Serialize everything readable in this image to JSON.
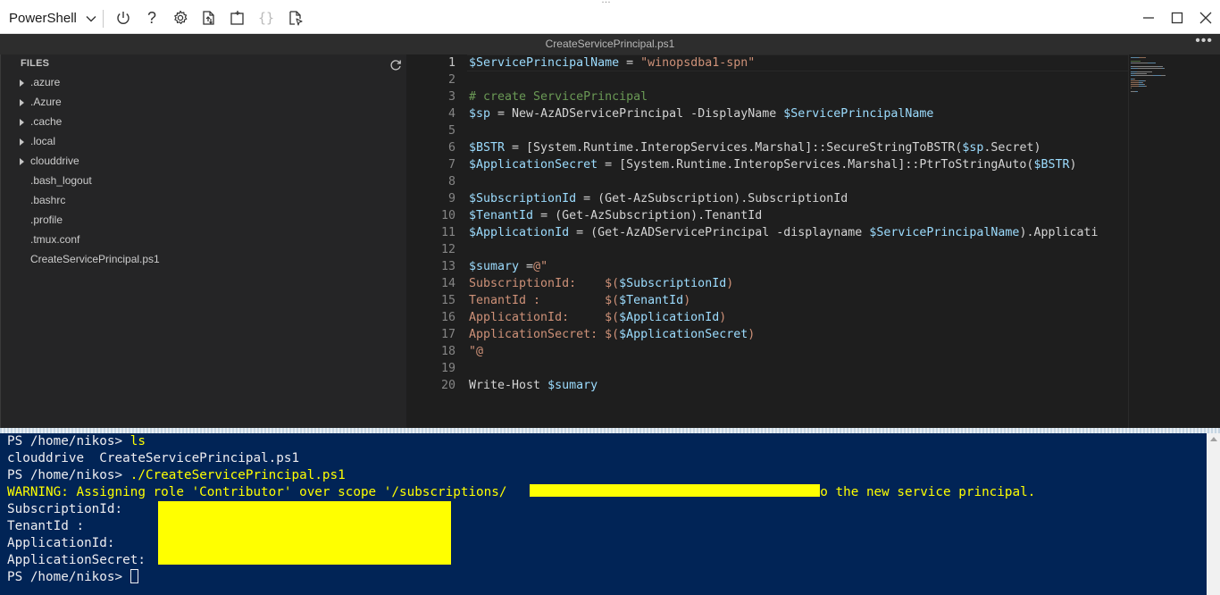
{
  "toolbar": {
    "shell_label": "PowerShell",
    "grip": "…",
    "buttons": [
      {
        "name": "restart",
        "icon": "power-icon"
      },
      {
        "name": "help",
        "icon": "help-icon",
        "glyph": "?"
      },
      {
        "name": "settings",
        "icon": "gear-icon"
      },
      {
        "name": "upload-download",
        "icon": "upload-download-icon"
      },
      {
        "name": "new-session",
        "icon": "new-session-icon"
      },
      {
        "name": "editor",
        "icon": "braces-icon",
        "glyph": "{}"
      },
      {
        "name": "web-preview",
        "icon": "web-preview-icon"
      }
    ],
    "window_controls": [
      "minimize-icon",
      "maximize-icon",
      "close-icon"
    ]
  },
  "editor": {
    "filename": "CreateServicePrincipal.ps1",
    "more_glyph": "•••",
    "active_line": 1,
    "line_numbers": [
      "1",
      "2",
      "3",
      "4",
      "5",
      "6",
      "7",
      "8",
      "9",
      "10",
      "11",
      "12",
      "13",
      "14",
      "15",
      "16",
      "17",
      "18",
      "19",
      "20"
    ],
    "code": [
      [
        {
          "t": "$ServicePrincipalName",
          "k": "v"
        },
        {
          "t": " = ",
          "k": "p"
        },
        {
          "t": "\"winopsdba1-spn\"",
          "k": "s"
        }
      ],
      [],
      [
        {
          "t": "# create ServicePrincipal",
          "k": "c"
        }
      ],
      [
        {
          "t": "$sp",
          "k": "v"
        },
        {
          "t": " = New-AzADServicePrincipal -DisplayName ",
          "k": "p"
        },
        {
          "t": "$ServicePrincipalName",
          "k": "v"
        }
      ],
      [],
      [
        {
          "t": "$BSTR",
          "k": "v"
        },
        {
          "t": " = [System.Runtime.InteropServices.Marshal]::SecureStringToBSTR(",
          "k": "p"
        },
        {
          "t": "$sp",
          "k": "v"
        },
        {
          "t": ".Secret)",
          "k": "p"
        }
      ],
      [
        {
          "t": "$ApplicationSecret",
          "k": "v"
        },
        {
          "t": " = [System.Runtime.InteropServices.Marshal]::PtrToStringAuto(",
          "k": "p"
        },
        {
          "t": "$BSTR",
          "k": "v"
        },
        {
          "t": ")",
          "k": "p"
        }
      ],
      [],
      [
        {
          "t": "$SubscriptionId",
          "k": "v"
        },
        {
          "t": " = (Get-AzSubscription).SubscriptionId",
          "k": "p"
        }
      ],
      [
        {
          "t": "$TenantId",
          "k": "v"
        },
        {
          "t": " = (Get-AzSubscription).TenantId",
          "k": "p"
        }
      ],
      [
        {
          "t": "$ApplicationId",
          "k": "v"
        },
        {
          "t": " = (Get-AzADServicePrincipal -displayname ",
          "k": "p"
        },
        {
          "t": "$ServicePrincipalName",
          "k": "v"
        },
        {
          "t": ").Applicati",
          "k": "p"
        }
      ],
      [],
      [
        {
          "t": "$sumary",
          "k": "v"
        },
        {
          "t": " =",
          "k": "p"
        },
        {
          "t": "@\"",
          "k": "s"
        }
      ],
      [
        {
          "t": "SubscriptionId:    $(",
          "k": "s"
        },
        {
          "t": "$SubscriptionId",
          "k": "v"
        },
        {
          "t": ")",
          "k": "s"
        }
      ],
      [
        {
          "t": "TenantId :         $(",
          "k": "s"
        },
        {
          "t": "$TenantId",
          "k": "v"
        },
        {
          "t": ")",
          "k": "s"
        }
      ],
      [
        {
          "t": "ApplicationId:     $(",
          "k": "s"
        },
        {
          "t": "$ApplicationId",
          "k": "v"
        },
        {
          "t": ")",
          "k": "s"
        }
      ],
      [
        {
          "t": "ApplicationSecret: $(",
          "k": "s"
        },
        {
          "t": "$ApplicationSecret",
          "k": "v"
        },
        {
          "t": ")",
          "k": "s"
        }
      ],
      [
        {
          "t": "\"@",
          "k": "s"
        }
      ],
      [],
      [
        {
          "t": "Write-Host ",
          "k": "p"
        },
        {
          "t": "$sumary",
          "k": "v"
        }
      ]
    ]
  },
  "explorer": {
    "header": "FILES",
    "items": [
      {
        "label": ".azure",
        "folder": true
      },
      {
        "label": ".Azure",
        "folder": true
      },
      {
        "label": ".cache",
        "folder": true
      },
      {
        "label": ".local",
        "folder": true
      },
      {
        "label": "clouddrive",
        "folder": true
      },
      {
        "label": ".bash_logout",
        "folder": false
      },
      {
        "label": ".bashrc",
        "folder": false
      },
      {
        "label": ".profile",
        "folder": false
      },
      {
        "label": ".tmux.conf",
        "folder": false
      },
      {
        "label": "CreateServicePrincipal.ps1",
        "folder": false
      }
    ]
  },
  "terminal": {
    "lines": [
      {
        "prompt": "PS /home/nikos> ",
        "cmd": "ls"
      },
      {
        "text": "clouddrive  CreateServicePrincipal.ps1"
      },
      {
        "prompt": "PS /home/nikos> ",
        "cmd": "./CreateServicePrincipal.ps1"
      },
      {
        "warn_prefix": "WARNING: Assigning role 'Contributor' over scope '/subscriptions/",
        "warn_suffix": "' to the new service principal."
      },
      {
        "text": "SubscriptionId:"
      },
      {
        "text": "TenantId :"
      },
      {
        "text": "ApplicationId:"
      },
      {
        "text": "ApplicationSecret:"
      },
      {
        "prompt": "PS /home/nikos> ",
        "cmd": ""
      }
    ],
    "colors": {
      "background": "#012456",
      "warning": "#ffff00",
      "redaction": "#ffff00"
    }
  }
}
